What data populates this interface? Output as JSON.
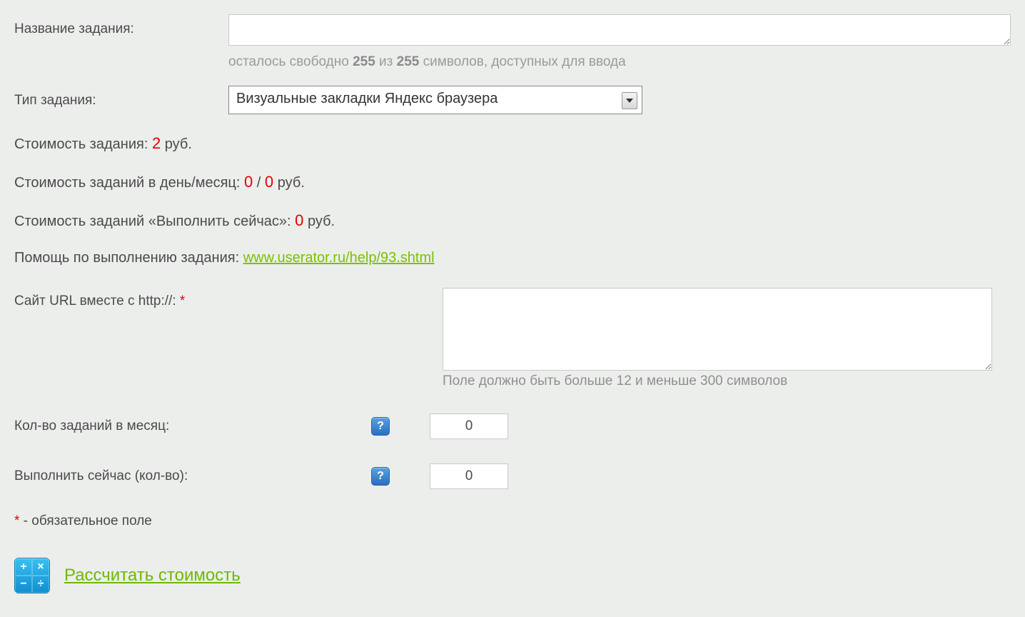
{
  "taskName": {
    "label": "Название задания:",
    "value": "",
    "counter_prefix": "осталось свободно ",
    "counter_remaining": "255",
    "counter_mid": " из ",
    "counter_total": "255",
    "counter_suffix": " символов, доступных для ввода"
  },
  "taskType": {
    "label": "Тип задания:",
    "selected": "Визуальные закладки Яндекс браузера"
  },
  "cost": {
    "label_prefix": "Стоимость задания: ",
    "value": "2",
    "unit": " руб."
  },
  "costDayMonth": {
    "label_prefix": "Стоимость заданий в день/месяц: ",
    "day": "0",
    "sep": " / ",
    "month": "0",
    "unit": " руб."
  },
  "costNow": {
    "label_prefix": "Стоимость заданий «Выполнить сейчас»: ",
    "value": "0",
    "unit": " руб."
  },
  "help": {
    "label": "Помощь по выполнению задания: ",
    "link_text": "www.userator.ru/help/93.shtml"
  },
  "url": {
    "label": "Сайт URL вместе с http://: ",
    "value": "",
    "hint": "Поле должно быть больше 12 и меньше 300 символов"
  },
  "qtyMonth": {
    "label": "Кол-во заданий в месяц:",
    "value": "0",
    "help": "?"
  },
  "qtyNow": {
    "label": "Выполнить сейчас (кол-во):",
    "value": "0",
    "help": "?"
  },
  "requiredNote": {
    "asterisk": "*",
    "text": " - обязательное поле"
  },
  "calc": {
    "link": "Рассчитать стоимость",
    "cells": [
      "+",
      "×",
      "−",
      "÷"
    ]
  }
}
